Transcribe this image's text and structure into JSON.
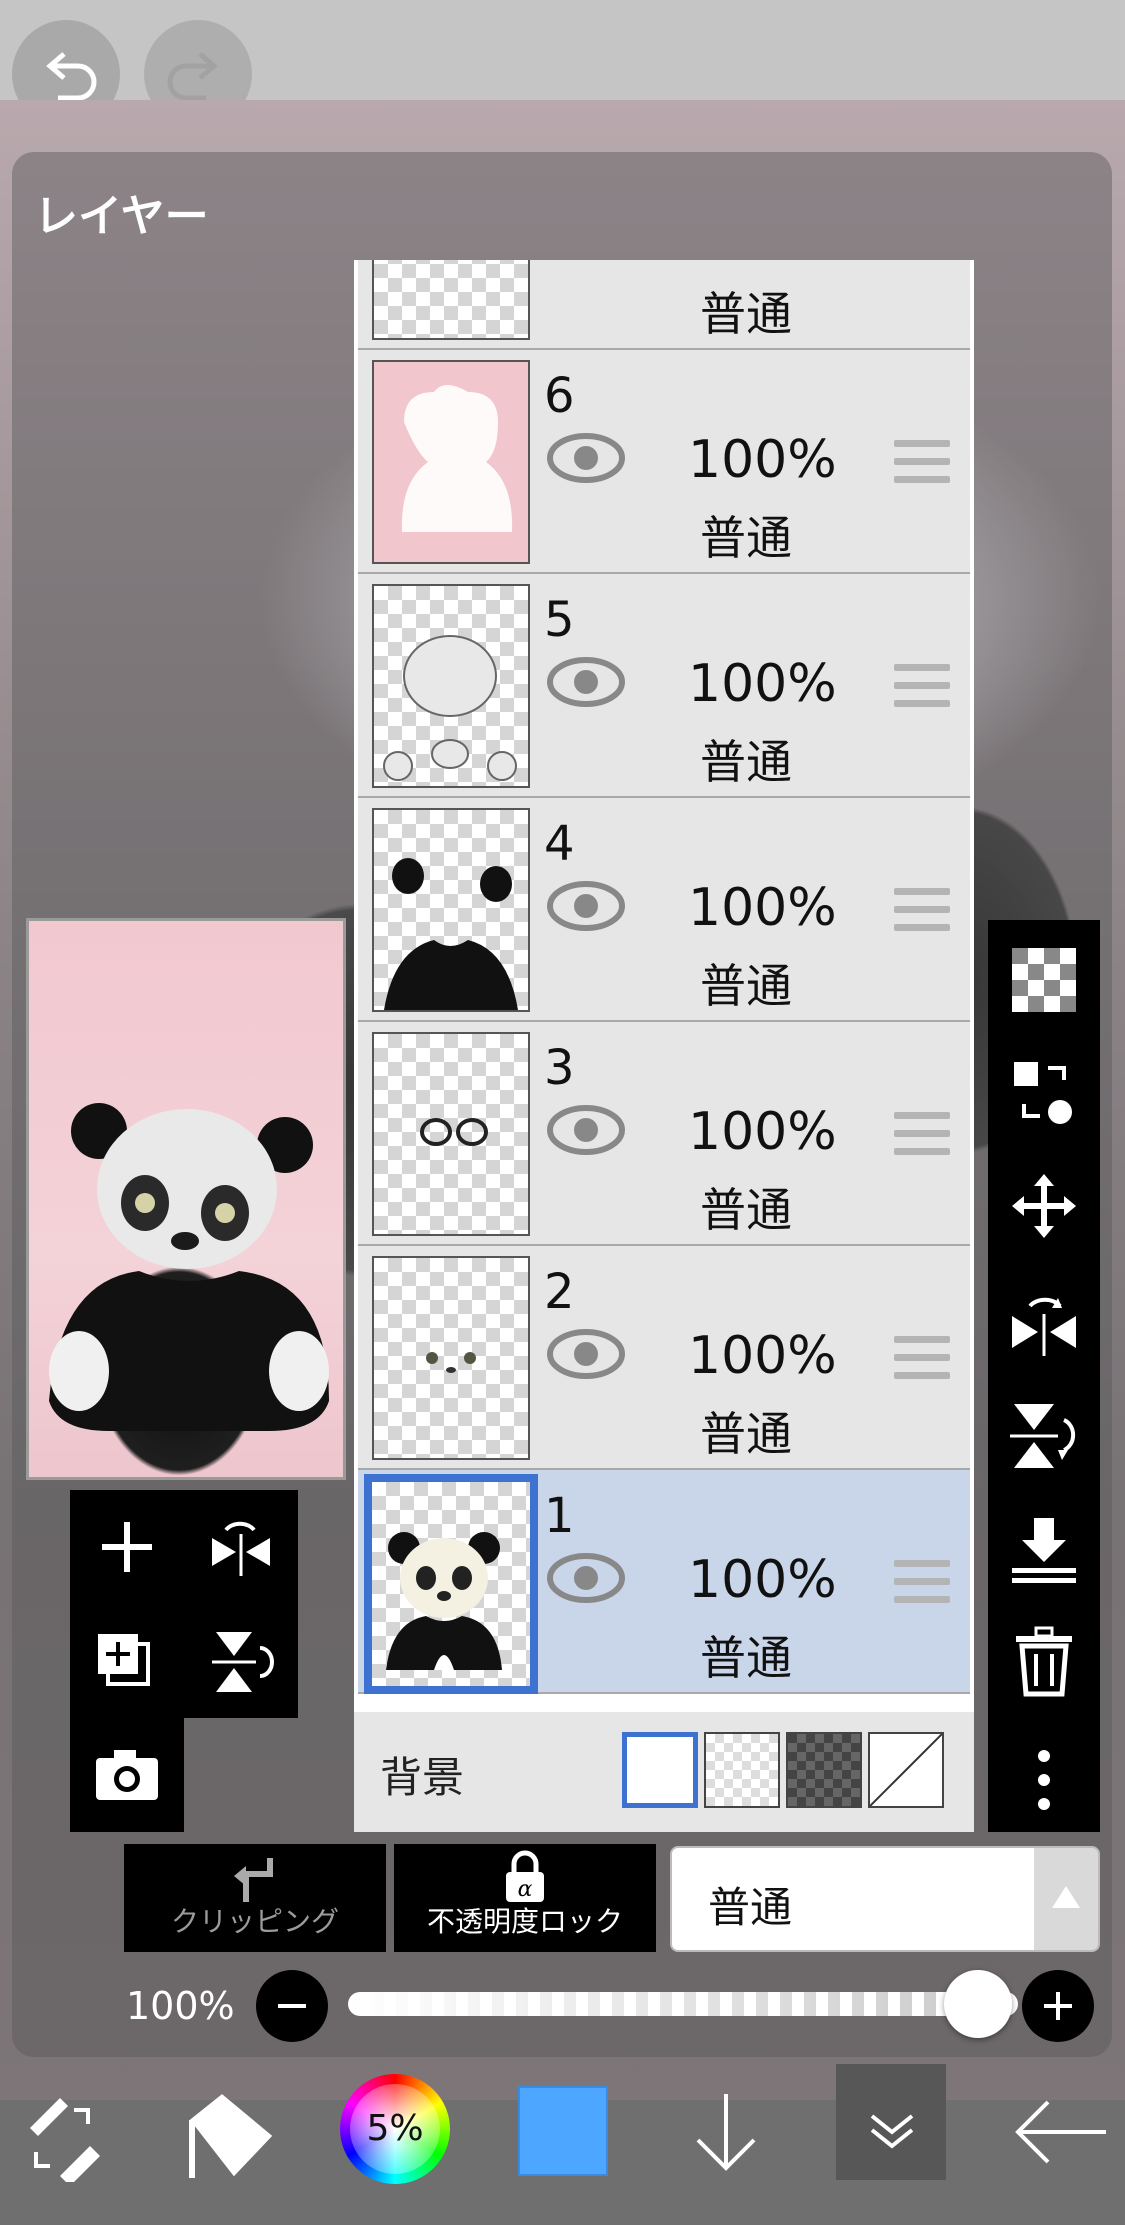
{
  "panel": {
    "title": "レイヤー"
  },
  "layers": [
    {
      "number": "",
      "opacity": "",
      "blend": "普通"
    },
    {
      "number": "6",
      "opacity": "100%",
      "blend": "普通"
    },
    {
      "number": "5",
      "opacity": "100%",
      "blend": "普通"
    },
    {
      "number": "4",
      "opacity": "100%",
      "blend": "普通"
    },
    {
      "number": "3",
      "opacity": "100%",
      "blend": "普通"
    },
    {
      "number": "2",
      "opacity": "100%",
      "blend": "普通"
    },
    {
      "number": "1",
      "opacity": "100%",
      "blend": "普通",
      "selected": true
    }
  ],
  "background": {
    "label": "背景"
  },
  "controls": {
    "clipping_label": "クリッピング",
    "opacity_lock_label": "不透明度ロック",
    "blend_mode_value": "普通",
    "opacity_value": "100%",
    "opacity_fraction": 1.0
  },
  "toolbar": {
    "brush_size": "5%",
    "color": "#4da6ff"
  },
  "colors": {
    "selection": "#3d72d1",
    "selected_row": "#c9d6e9"
  }
}
